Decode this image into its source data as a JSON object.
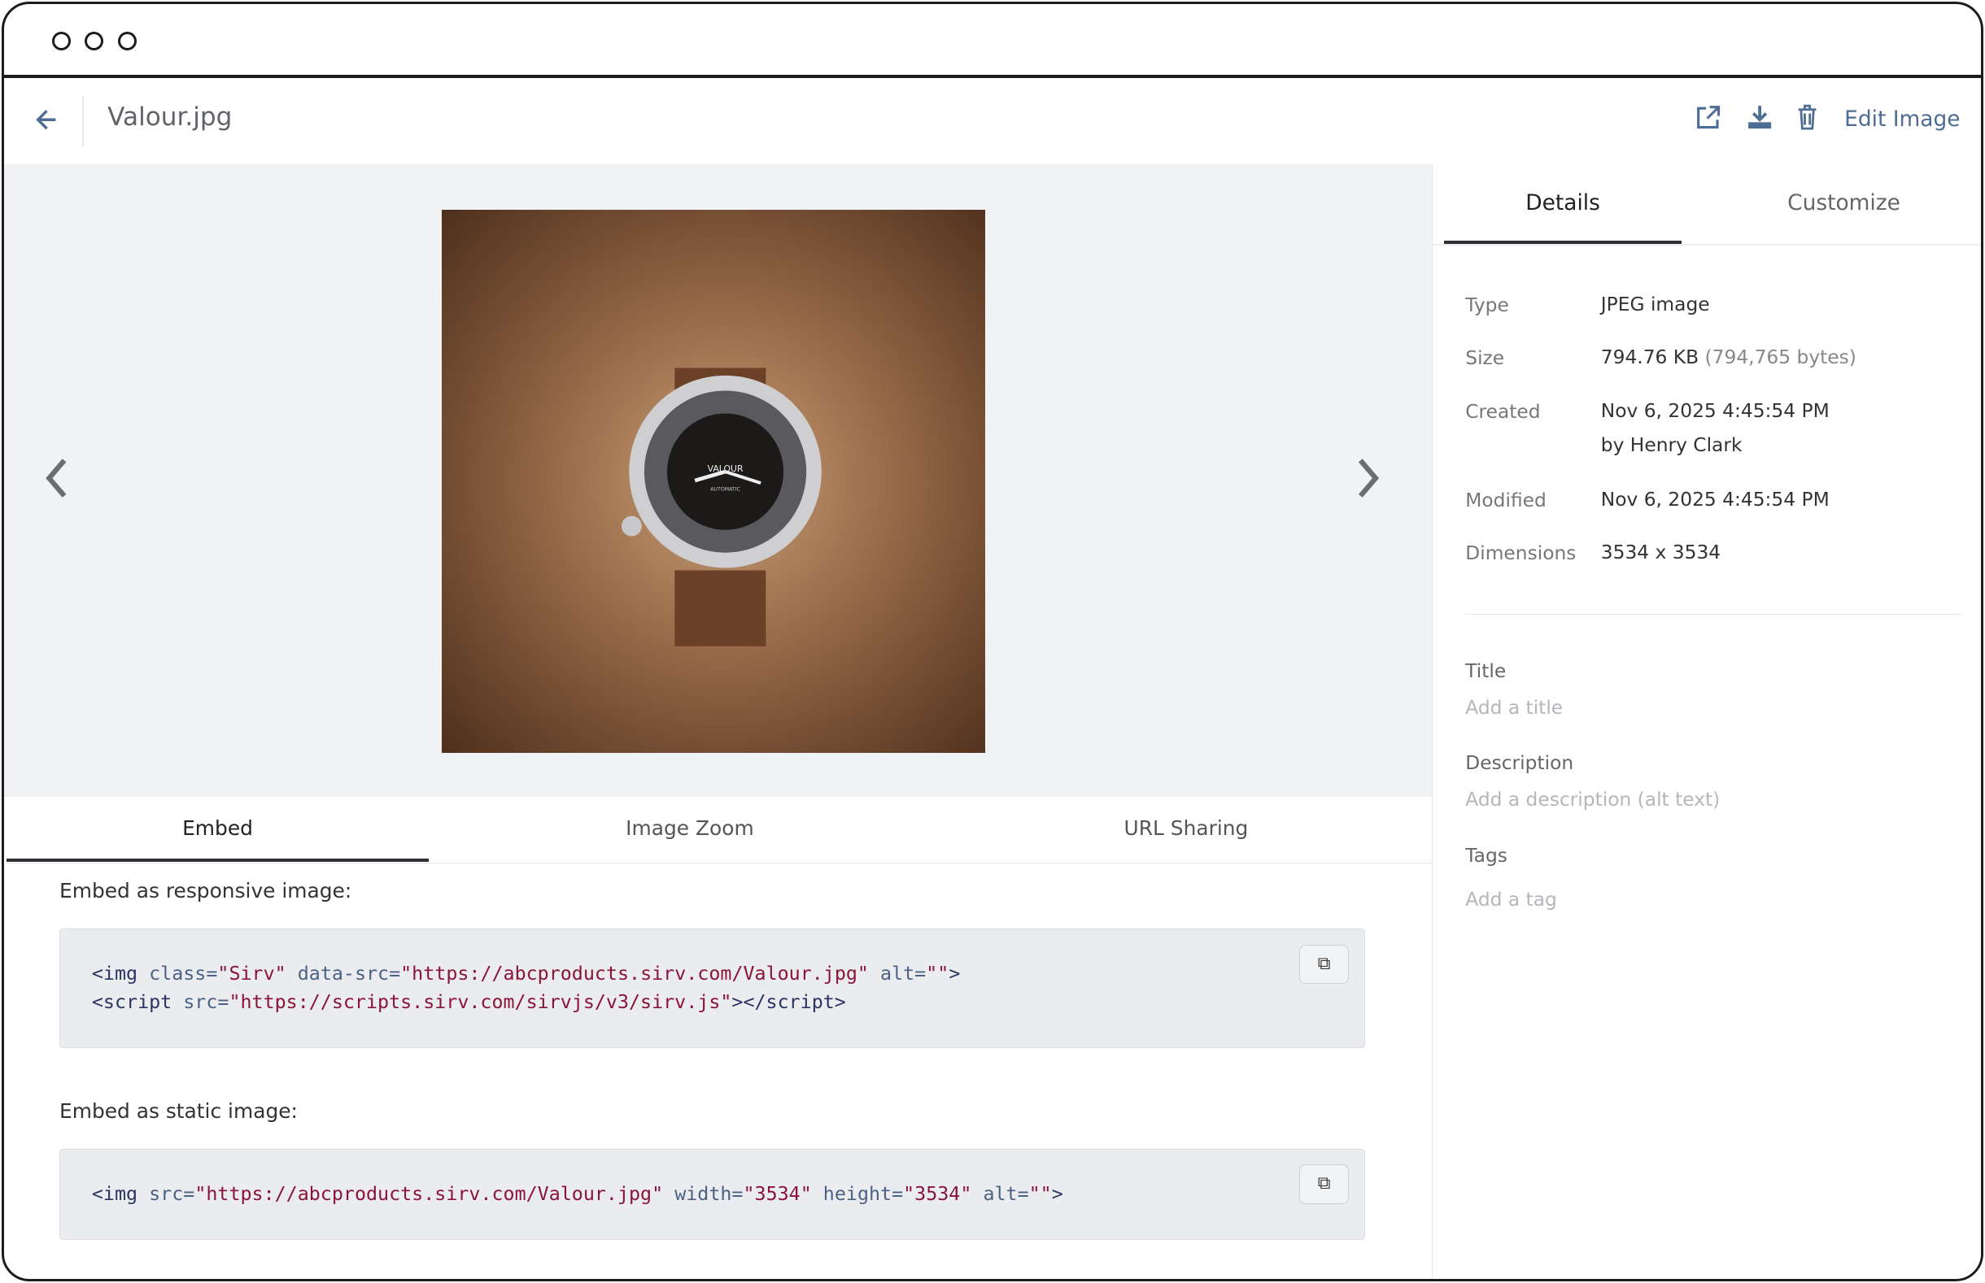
{
  "header": {
    "filename": "Valour.jpg",
    "edit_label": "Edit Image"
  },
  "tabs": {
    "embed": "Embed",
    "zoom": "Image Zoom",
    "url": "URL Sharing"
  },
  "embed": {
    "responsive_label": "Embed as responsive image:",
    "responsive_code_line1": [
      "<img ",
      "class=",
      "\"Sirv\"",
      " data-src=",
      "\"https://abcproducts.sirv.com/Valour.jpg\"",
      " alt=",
      "\"\"",
      ">"
    ],
    "responsive_code_line2": [
      "<script ",
      "src=",
      "\"https://scripts.sirv.com/sirvjs/v3/sirv.js\"",
      "></script>"
    ],
    "static_label": "Embed as static image:",
    "static_code": [
      "<img ",
      "src=",
      "\"https://abcproducts.sirv.com/Valour.jpg\"",
      " width=",
      "\"3534\"",
      " height=",
      "\"3534\"",
      " alt=",
      "\"\"",
      ">"
    ]
  },
  "side": {
    "tabs": [
      "Details",
      "Customize"
    ],
    "details": [
      {
        "label": "Type",
        "value": "JPEG image"
      },
      {
        "label": "Size",
        "value": "794.76 KB",
        "muted": "(794,765 bytes)"
      },
      {
        "label": "Created",
        "value": "Nov 6, 2025 4:45:54 PM",
        "value2": "by Henry Clark"
      },
      {
        "label": "Modified",
        "value": "Nov 6, 2025 4:45:54 PM"
      },
      {
        "label": "Dimensions",
        "value": "3534 x 3534"
      }
    ],
    "title_label": "Title",
    "title_placeholder": "Add a title",
    "desc_label": "Description",
    "desc_placeholder": "Add a description (alt text)",
    "tags_label": "Tags",
    "tags_placeholder": "Add a tag"
  },
  "photo": {
    "brand": "VALOUR",
    "subtitle": "AUTOMATIC"
  }
}
